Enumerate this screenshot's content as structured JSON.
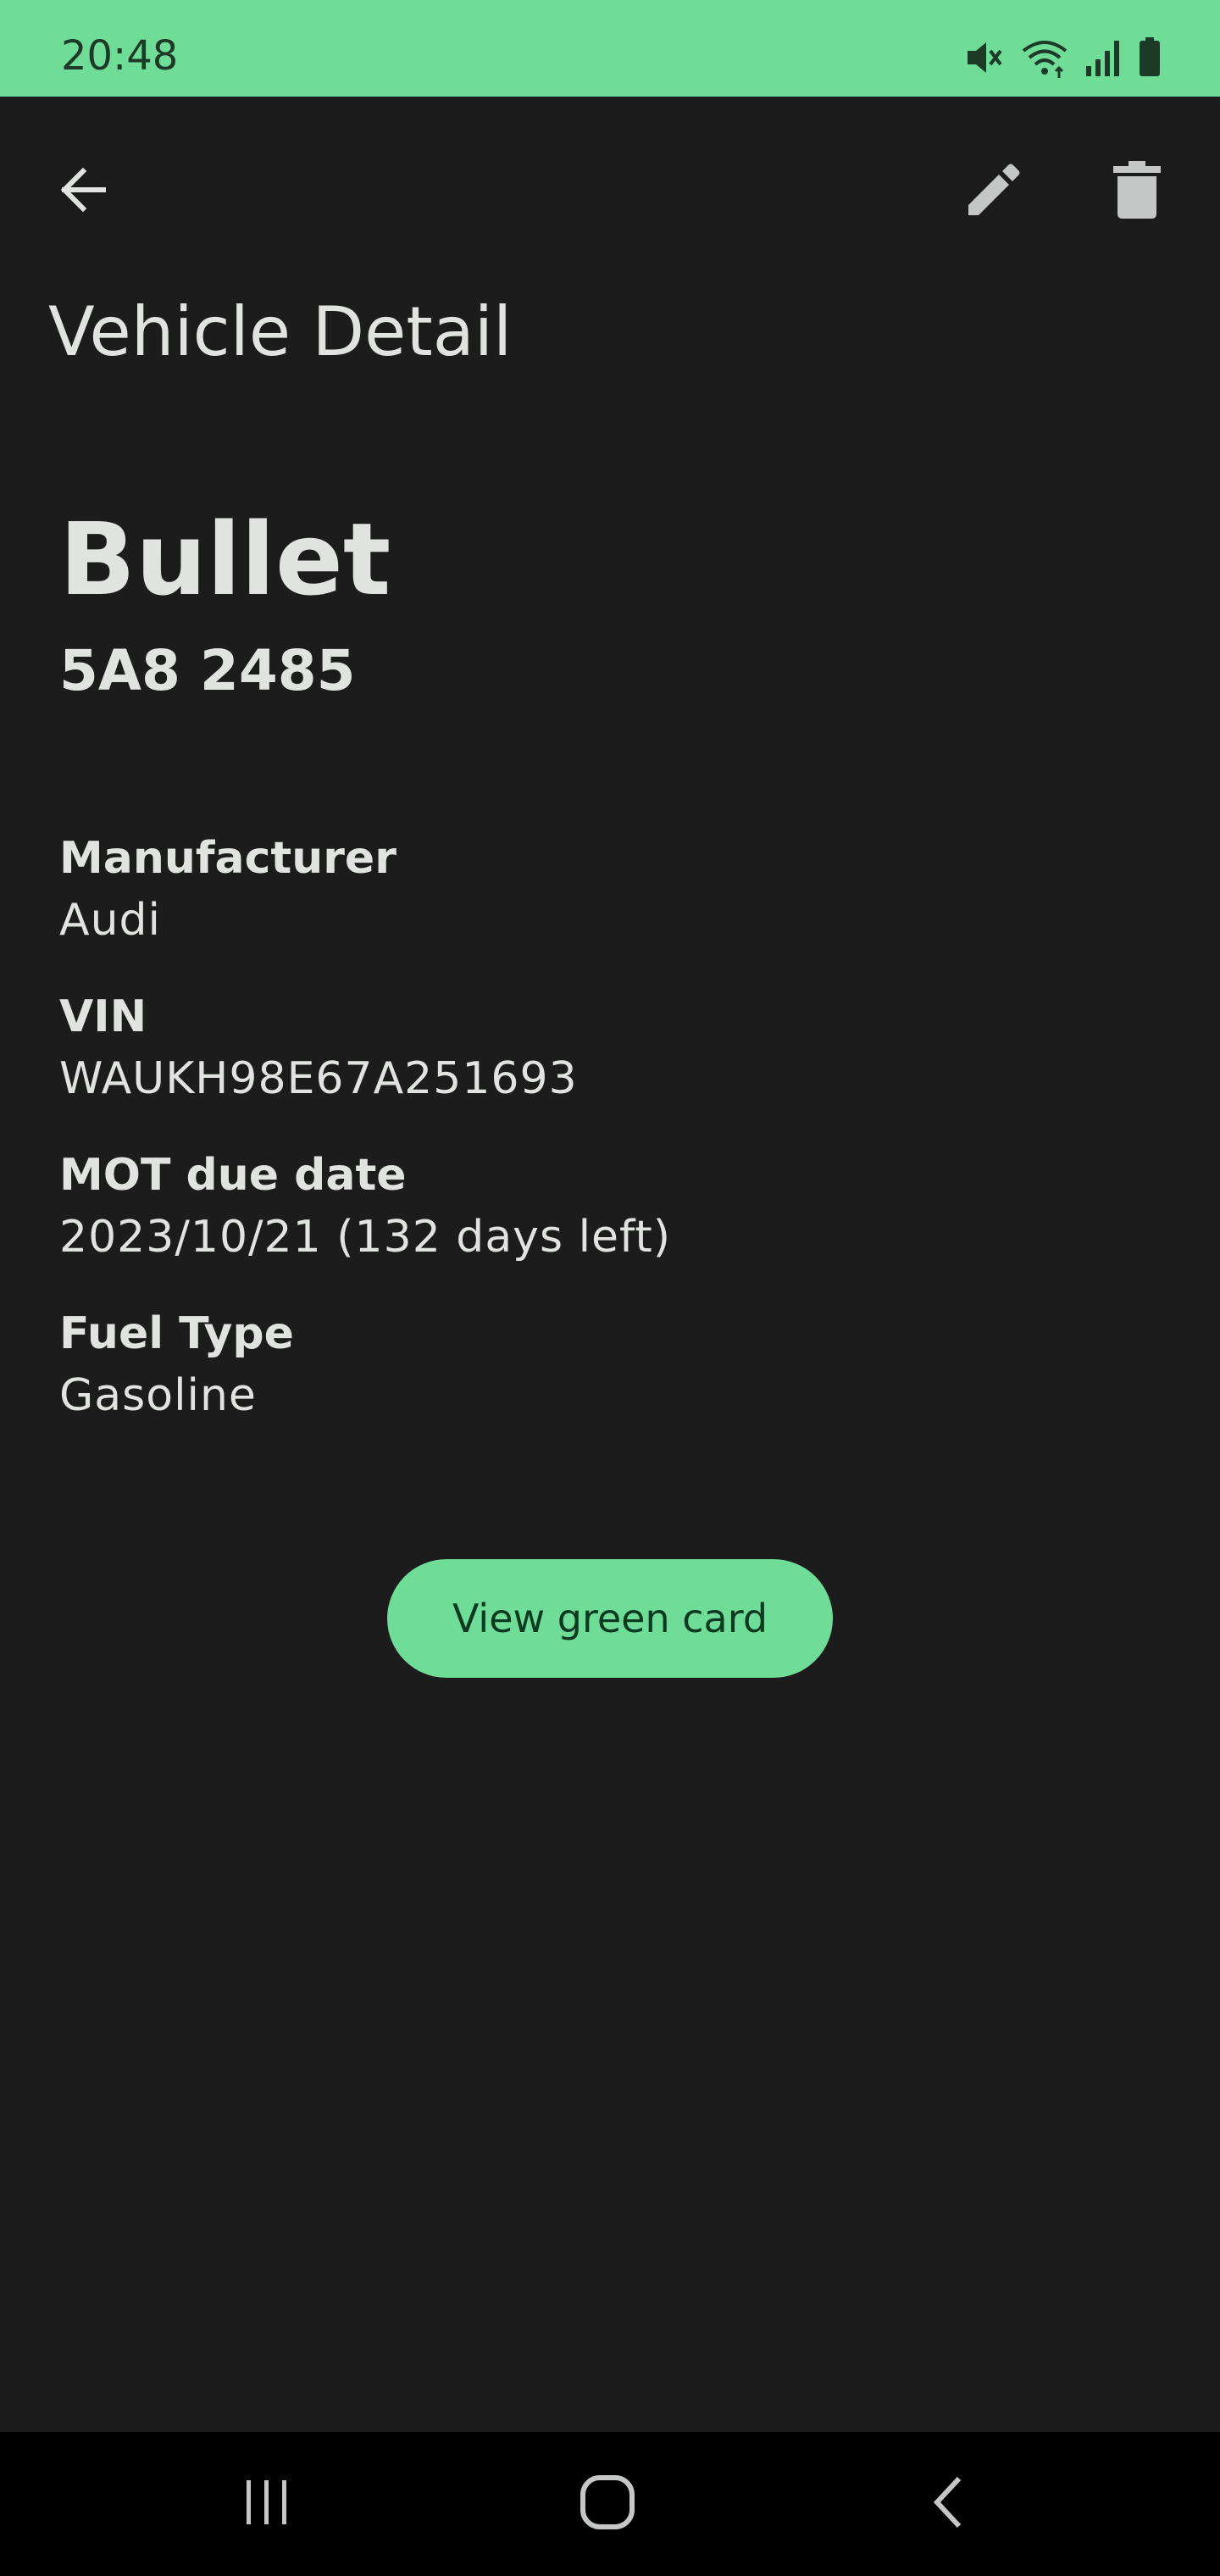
{
  "status_bar": {
    "time": "20:48",
    "icons": [
      "mute-icon",
      "wifi-icon",
      "signal-icon",
      "battery-icon"
    ],
    "background": "#6fdc98"
  },
  "app_bar": {
    "back_icon": "arrow-back-icon",
    "edit_icon": "pencil-icon",
    "delete_icon": "trash-icon"
  },
  "page": {
    "title": "Vehicle Detail"
  },
  "vehicle": {
    "name": "Bullet",
    "plate": "5A8 2485",
    "fields": {
      "manufacturer": {
        "label": "Manufacturer",
        "value": "Audi"
      },
      "vin": {
        "label": "VIN",
        "value": "WAUKH98E67A251693"
      },
      "mot": {
        "label": "MOT due date",
        "value": "2023/10/21 (132 days left)"
      },
      "fuel": {
        "label": "Fuel Type",
        "value": "Gasoline"
      }
    }
  },
  "actions": {
    "green_card_label": "View green card",
    "accent_color": "#6fdc98"
  },
  "nav_bar": {
    "icons": [
      "recents-icon",
      "home-icon",
      "back-icon"
    ]
  }
}
